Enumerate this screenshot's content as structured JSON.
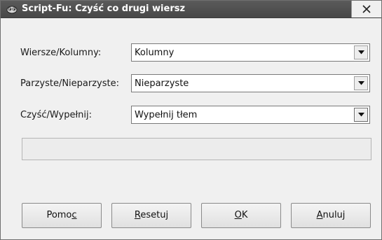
{
  "window": {
    "title": "Script-Fu: Czyść co drugi wiersz",
    "close_glyph": "✕"
  },
  "fields": [
    {
      "label": "Wiersze/Kolumny:",
      "value": "Kolumny"
    },
    {
      "label": "Parzyste/Nieparzyste:",
      "value": "Nieparzyste"
    },
    {
      "label": "Czyść/Wypełnij:",
      "value": "Wypełnij tłem"
    }
  ],
  "progress": {
    "text": ""
  },
  "buttons": {
    "help": {
      "before": "Pomo",
      "mnemonic": "c",
      "after": ""
    },
    "reset": {
      "before": "",
      "mnemonic": "R",
      "after": "esetuj"
    },
    "ok": {
      "before": "",
      "mnemonic": "O",
      "after": "K"
    },
    "cancel": {
      "before": "",
      "mnemonic": "A",
      "after": "nuluj"
    }
  },
  "icons": {
    "title": "script-fu-eye-icon",
    "close": "close-icon",
    "dropdown": "chevron-down-icon"
  }
}
